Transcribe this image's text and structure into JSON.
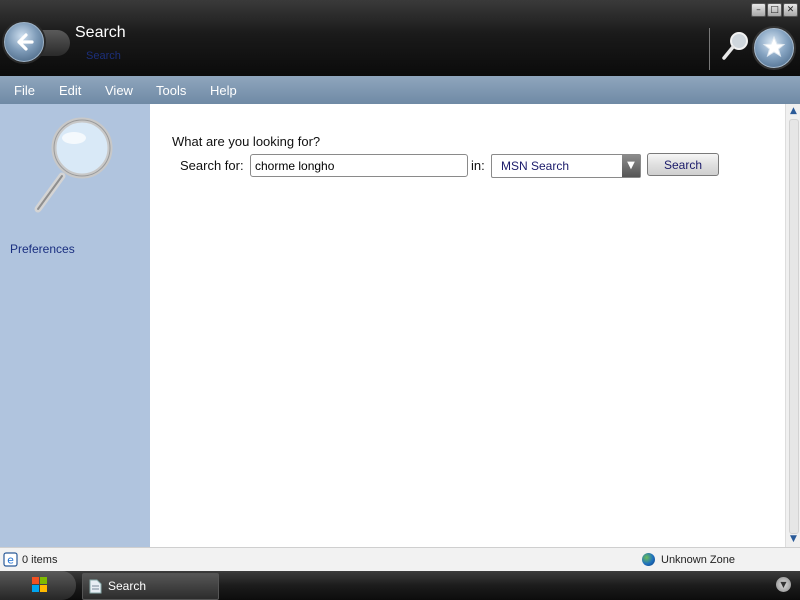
{
  "window": {
    "title": "Search",
    "subtitle": "Search",
    "controls": {
      "minimize": "–",
      "maximize": "□",
      "close": "✕"
    }
  },
  "menu": [
    {
      "label": "File"
    },
    {
      "label": "Edit"
    },
    {
      "label": "View"
    },
    {
      "label": "Tools"
    },
    {
      "label": "Help"
    }
  ],
  "sidebar": {
    "preferences_label": "Preferences"
  },
  "search": {
    "question": "What are you looking for?",
    "search_for_label": "Search for:",
    "query_value": "chorme longho",
    "in_label": "in:",
    "provider_selected": "MSN Search",
    "button_label": "Search"
  },
  "status": {
    "items": "0 items",
    "zone": "Unknown Zone"
  },
  "taskbar": {
    "task_label": "Search"
  },
  "colors": {
    "menubar": "#7a93ad",
    "sidebar": "#b0c4de",
    "link": "#1a2f80",
    "titlebar": "#141414"
  },
  "icons": {
    "back": "back-arrow-icon",
    "search_tool": "magnifier-icon",
    "favorites": "star-icon",
    "sidebar_art": "magnifier-icon",
    "status": "ie-page-icon",
    "zone": "globe-icon",
    "start": "windows-logo-icon",
    "task": "document-icon"
  }
}
